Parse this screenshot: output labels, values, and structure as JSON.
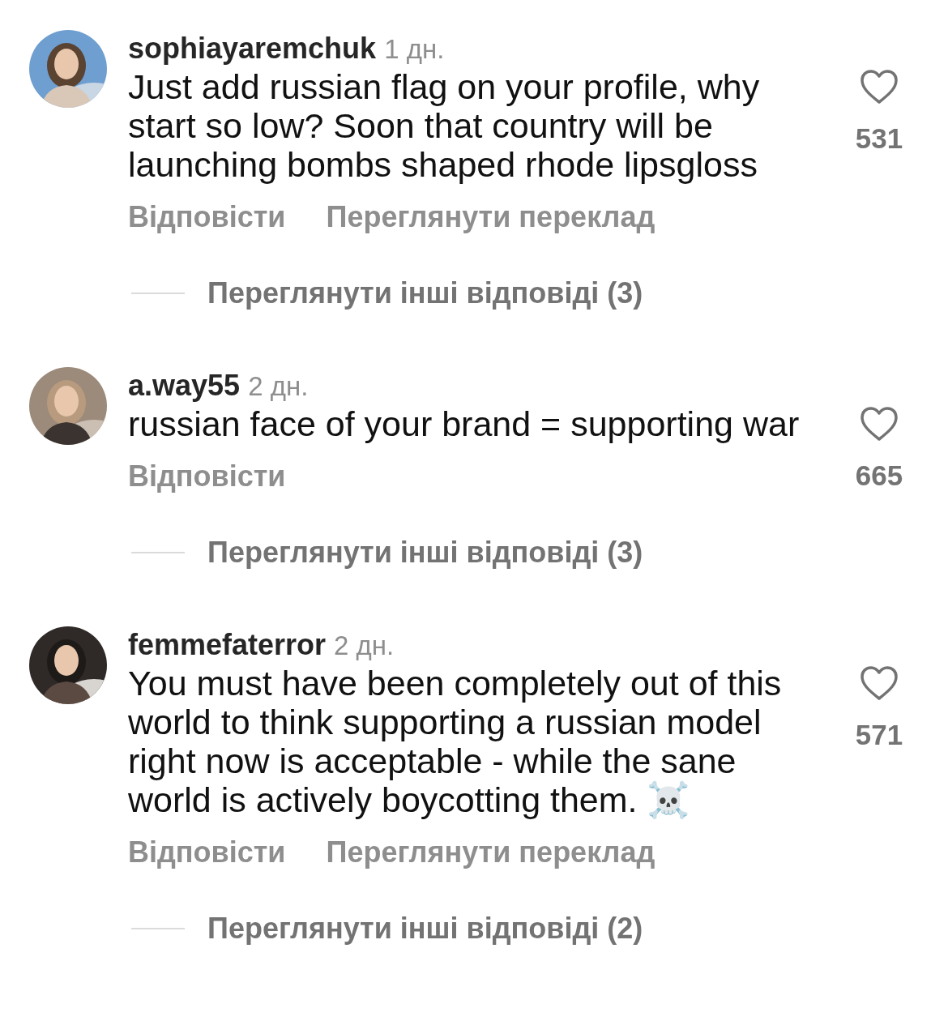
{
  "comments": [
    {
      "username": "sophiayaremchuk",
      "time": "1 дн.",
      "text": "Just add russian flag on your profile, why start so low? Soon that country will be launching bombs shaped rhode lipsgloss",
      "liked": false,
      "likes": "531",
      "actions": [
        "Відповісти",
        "Переглянути переклад"
      ],
      "replies_link": "Переглянути інші відповіді (3)"
    },
    {
      "username": "a.way55",
      "time": "2 дн.",
      "text": "russian face of your brand = supporting war",
      "liked": false,
      "likes": "665",
      "actions": [
        "Відповісти"
      ],
      "replies_link": "Переглянути інші відповіді (3)"
    },
    {
      "username": "femmefaterror",
      "time": "2 дн.",
      "text": "You must have been completely out of this world to think supporting a russian model right now is acceptable - while the sane world is actively boycotting them. ☠️",
      "liked": false,
      "likes": "571",
      "actions": [
        "Відповісти",
        "Переглянути переклад"
      ],
      "replies_link": "Переглянути інші відповіді (2)"
    }
  ]
}
